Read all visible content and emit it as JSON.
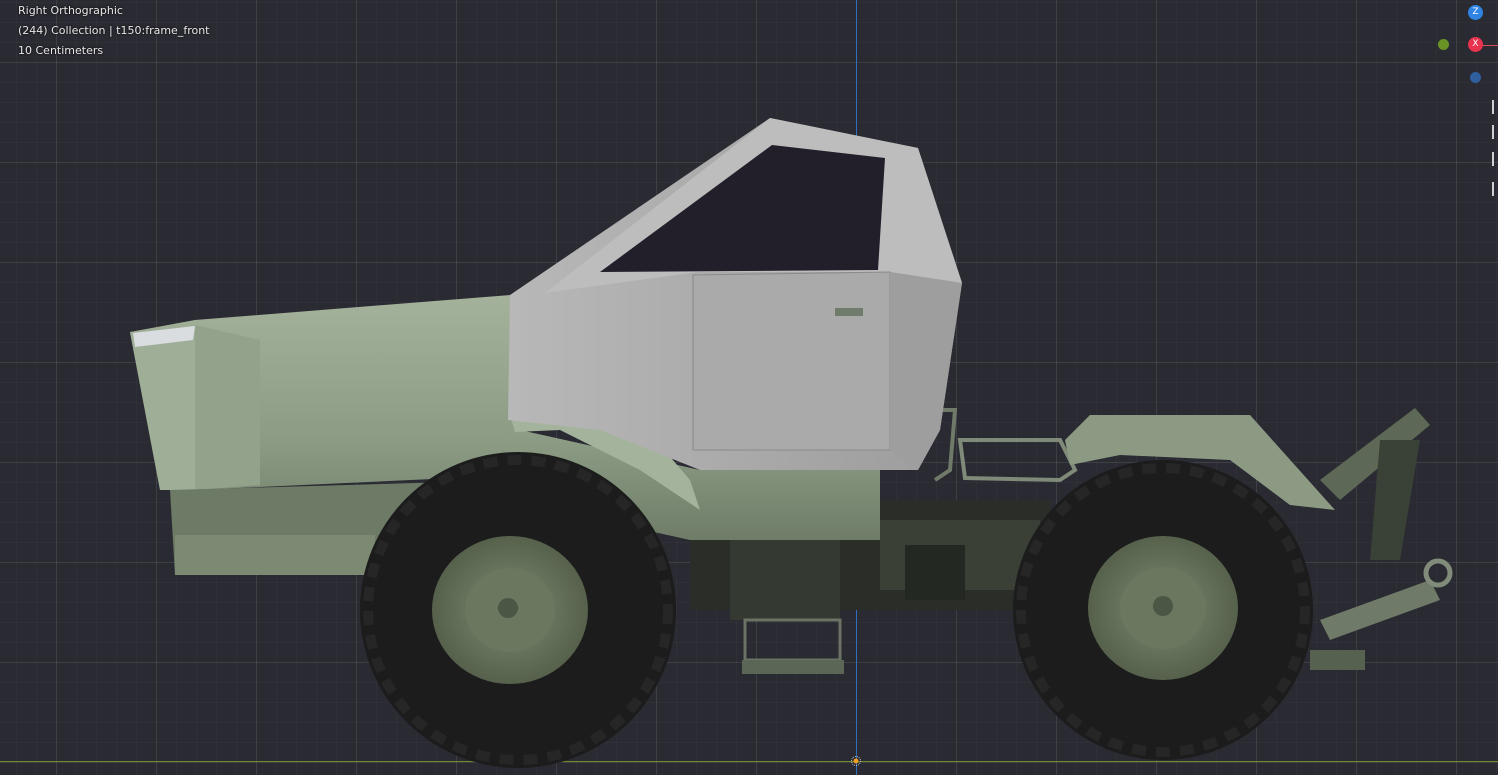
{
  "viewport": {
    "view_name": "Right Orthographic",
    "collection_info": "(244) Collection | t150:frame_front",
    "scale_info": "10 Centimeters"
  },
  "gizmo": {
    "z_label": "Z",
    "x_label": "X",
    "z_color": "#2f84e3",
    "x_color": "#e8334f",
    "y_color": "#6a9326",
    "neg_z_color": "#2f5f9f"
  },
  "colors": {
    "grid_background": "#2a2a32",
    "z_axis_line": "#2f6fbf",
    "y_axis_line": "#6f8a2a",
    "body_green": "#8e9d86",
    "cab_grey": "#a9a9a9",
    "tire": "#1c1c1c",
    "rim": "#6e7a62"
  },
  "icons": {
    "origin": "origin-marker-icon",
    "toolbar": [
      "tool-icon-1",
      "tool-icon-2",
      "tool-icon-3",
      "tool-icon-4"
    ]
  }
}
